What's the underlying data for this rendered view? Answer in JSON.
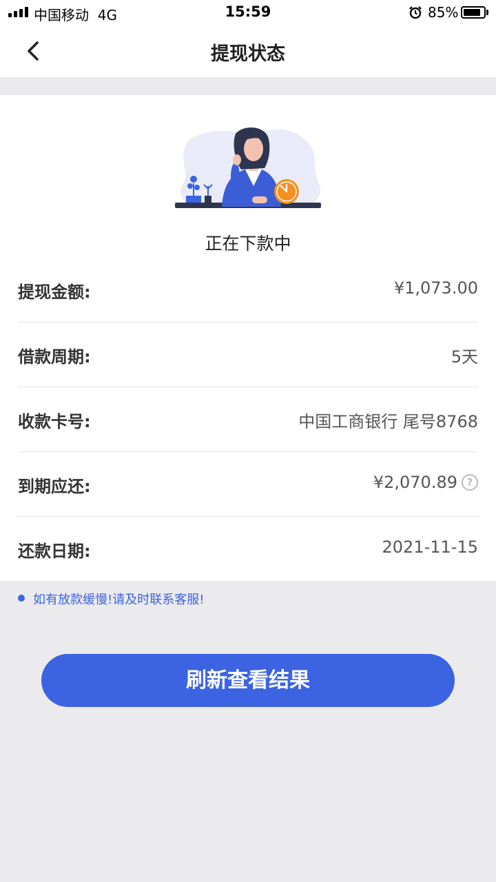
{
  "status_bar": {
    "carrier": "中国移动",
    "network": "4G",
    "time": "15:59",
    "battery_percent": "85%",
    "battery_level": 0.85,
    "icons": [
      "signal-icon",
      "alarm-icon",
      "battery-icon"
    ]
  },
  "nav": {
    "title": "提现状态",
    "back_icon": "chevron-left-icon"
  },
  "status": {
    "text": "正在下款中",
    "illustration": "woman-at-desk-with-clock-illustration"
  },
  "details": [
    {
      "label": "提现金额:",
      "value": "¥1,073.00"
    },
    {
      "label": "借款周期:",
      "value": "5天"
    },
    {
      "label": "收款卡号:",
      "value": "中国工商银行 尾号8768"
    },
    {
      "label": "到期应还:",
      "value": "¥2,070.89",
      "help_icon": "question-circle-icon"
    },
    {
      "label": "还款日期:",
      "value": "2021-11-15"
    }
  ],
  "notice": {
    "text": "如有放款缓慢!请及时联系客服!"
  },
  "actions": {
    "refresh_label": "刷新查看结果"
  },
  "colors": {
    "accent": "#3b63e2",
    "background": "#ebebed",
    "card": "#ffffff",
    "clock_orange": "#f5911f"
  }
}
